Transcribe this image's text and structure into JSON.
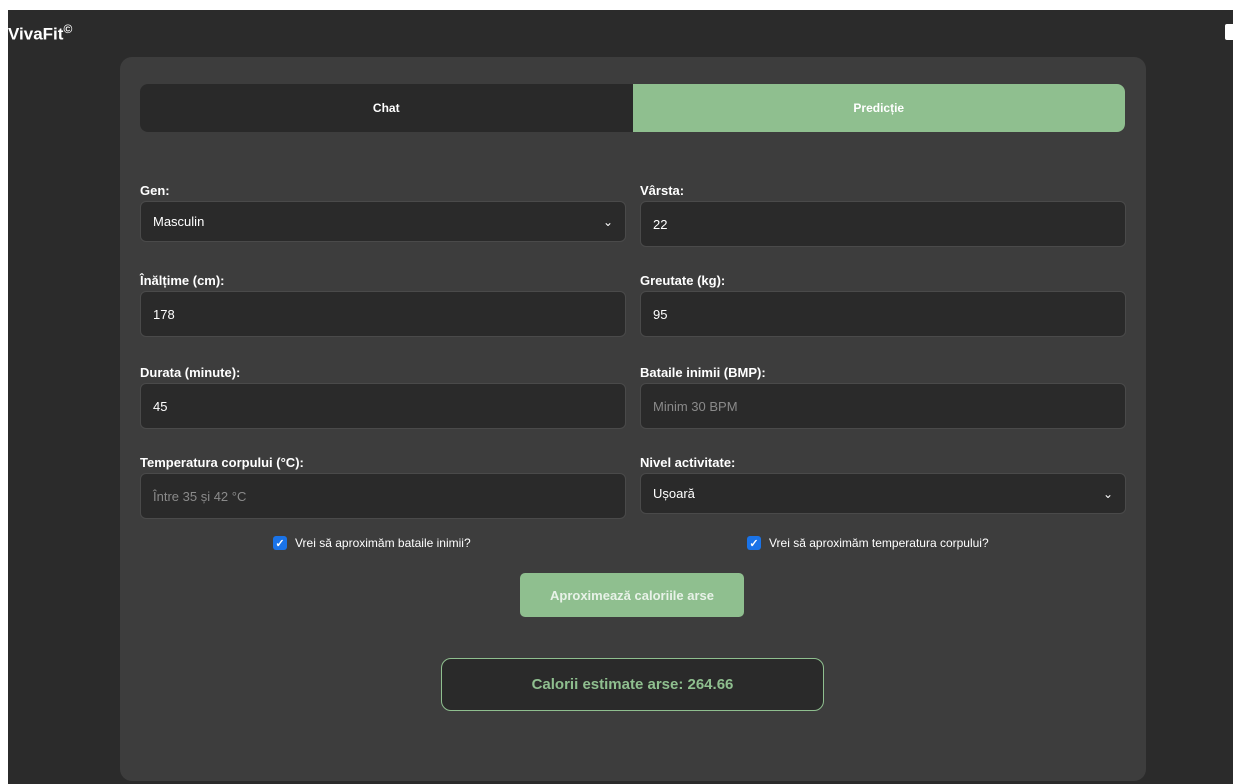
{
  "brand": {
    "name": "VivaFit",
    "mark": "©"
  },
  "tabs": [
    {
      "label": "Chat",
      "active": false
    },
    {
      "label": "Predicție",
      "active": true
    }
  ],
  "form": {
    "gen": {
      "label": "Gen:",
      "value": "Masculin"
    },
    "varsta": {
      "label": "Vârsta:",
      "value": "22"
    },
    "inaltime": {
      "label": "Înălțime (cm):",
      "value": "178"
    },
    "greutate": {
      "label": "Greutate (kg):",
      "value": "95"
    },
    "durata": {
      "label": "Durata (minute):",
      "value": "45"
    },
    "bataile": {
      "label": "Bataile inimii (BMP):",
      "placeholder": "Minim 30 BPM"
    },
    "temperatura": {
      "label": "Temperatura corpului (°C):",
      "placeholder": "Între 35 și 42 °C"
    },
    "nivel": {
      "label": "Nivel activitate:",
      "value": "Ușoară"
    }
  },
  "checkboxes": {
    "heart": {
      "label": "Vrei să aproximăm bataile inimii?",
      "checked": true
    },
    "temp": {
      "label": "Vrei să aproximăm temperatura corpului?",
      "checked": true
    }
  },
  "submit_label": "Aproximează caloriile arse",
  "result_text": "Calorii estimate arse: 264.66",
  "colors": {
    "accent": "#8fbf8f",
    "background": "#2b2b2b",
    "card": "#3d3d3d",
    "checkbox": "#1a73e8"
  }
}
